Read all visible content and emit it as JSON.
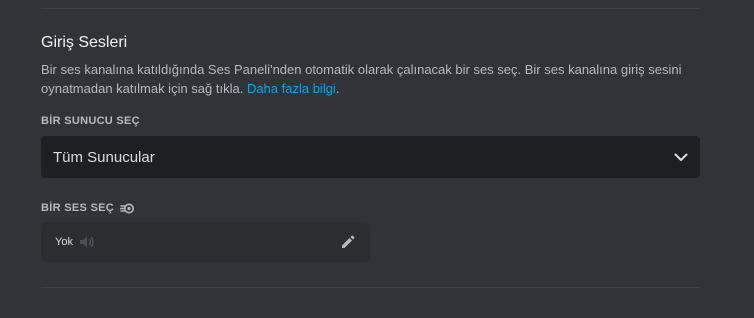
{
  "section": {
    "title": "Giriş Sesleri",
    "description": "Bir ses kanalına katıldığında Ses Paneli'nden otomatik olarak çalınacak bir ses seç. Bir ses kanalına giriş sesini oynatmadan katılmak için sağ tıkla. ",
    "link_text": "Daha fazla bilgi",
    "description_end": "."
  },
  "server_select": {
    "label": "BİR SUNUCU SEÇ",
    "value": "Tüm Sunucular",
    "icon": "chevron-down-icon"
  },
  "sound_select": {
    "label": "BİR SES SEÇ",
    "label_icon": "nitro-icon",
    "current": "Yok",
    "speaker_icon": "speaker-icon",
    "edit_icon": "pencil-icon"
  },
  "colors": {
    "background": "#313338",
    "input_bg": "#1e1f22",
    "card_bg": "#2b2d31",
    "link": "#00a8fc"
  }
}
